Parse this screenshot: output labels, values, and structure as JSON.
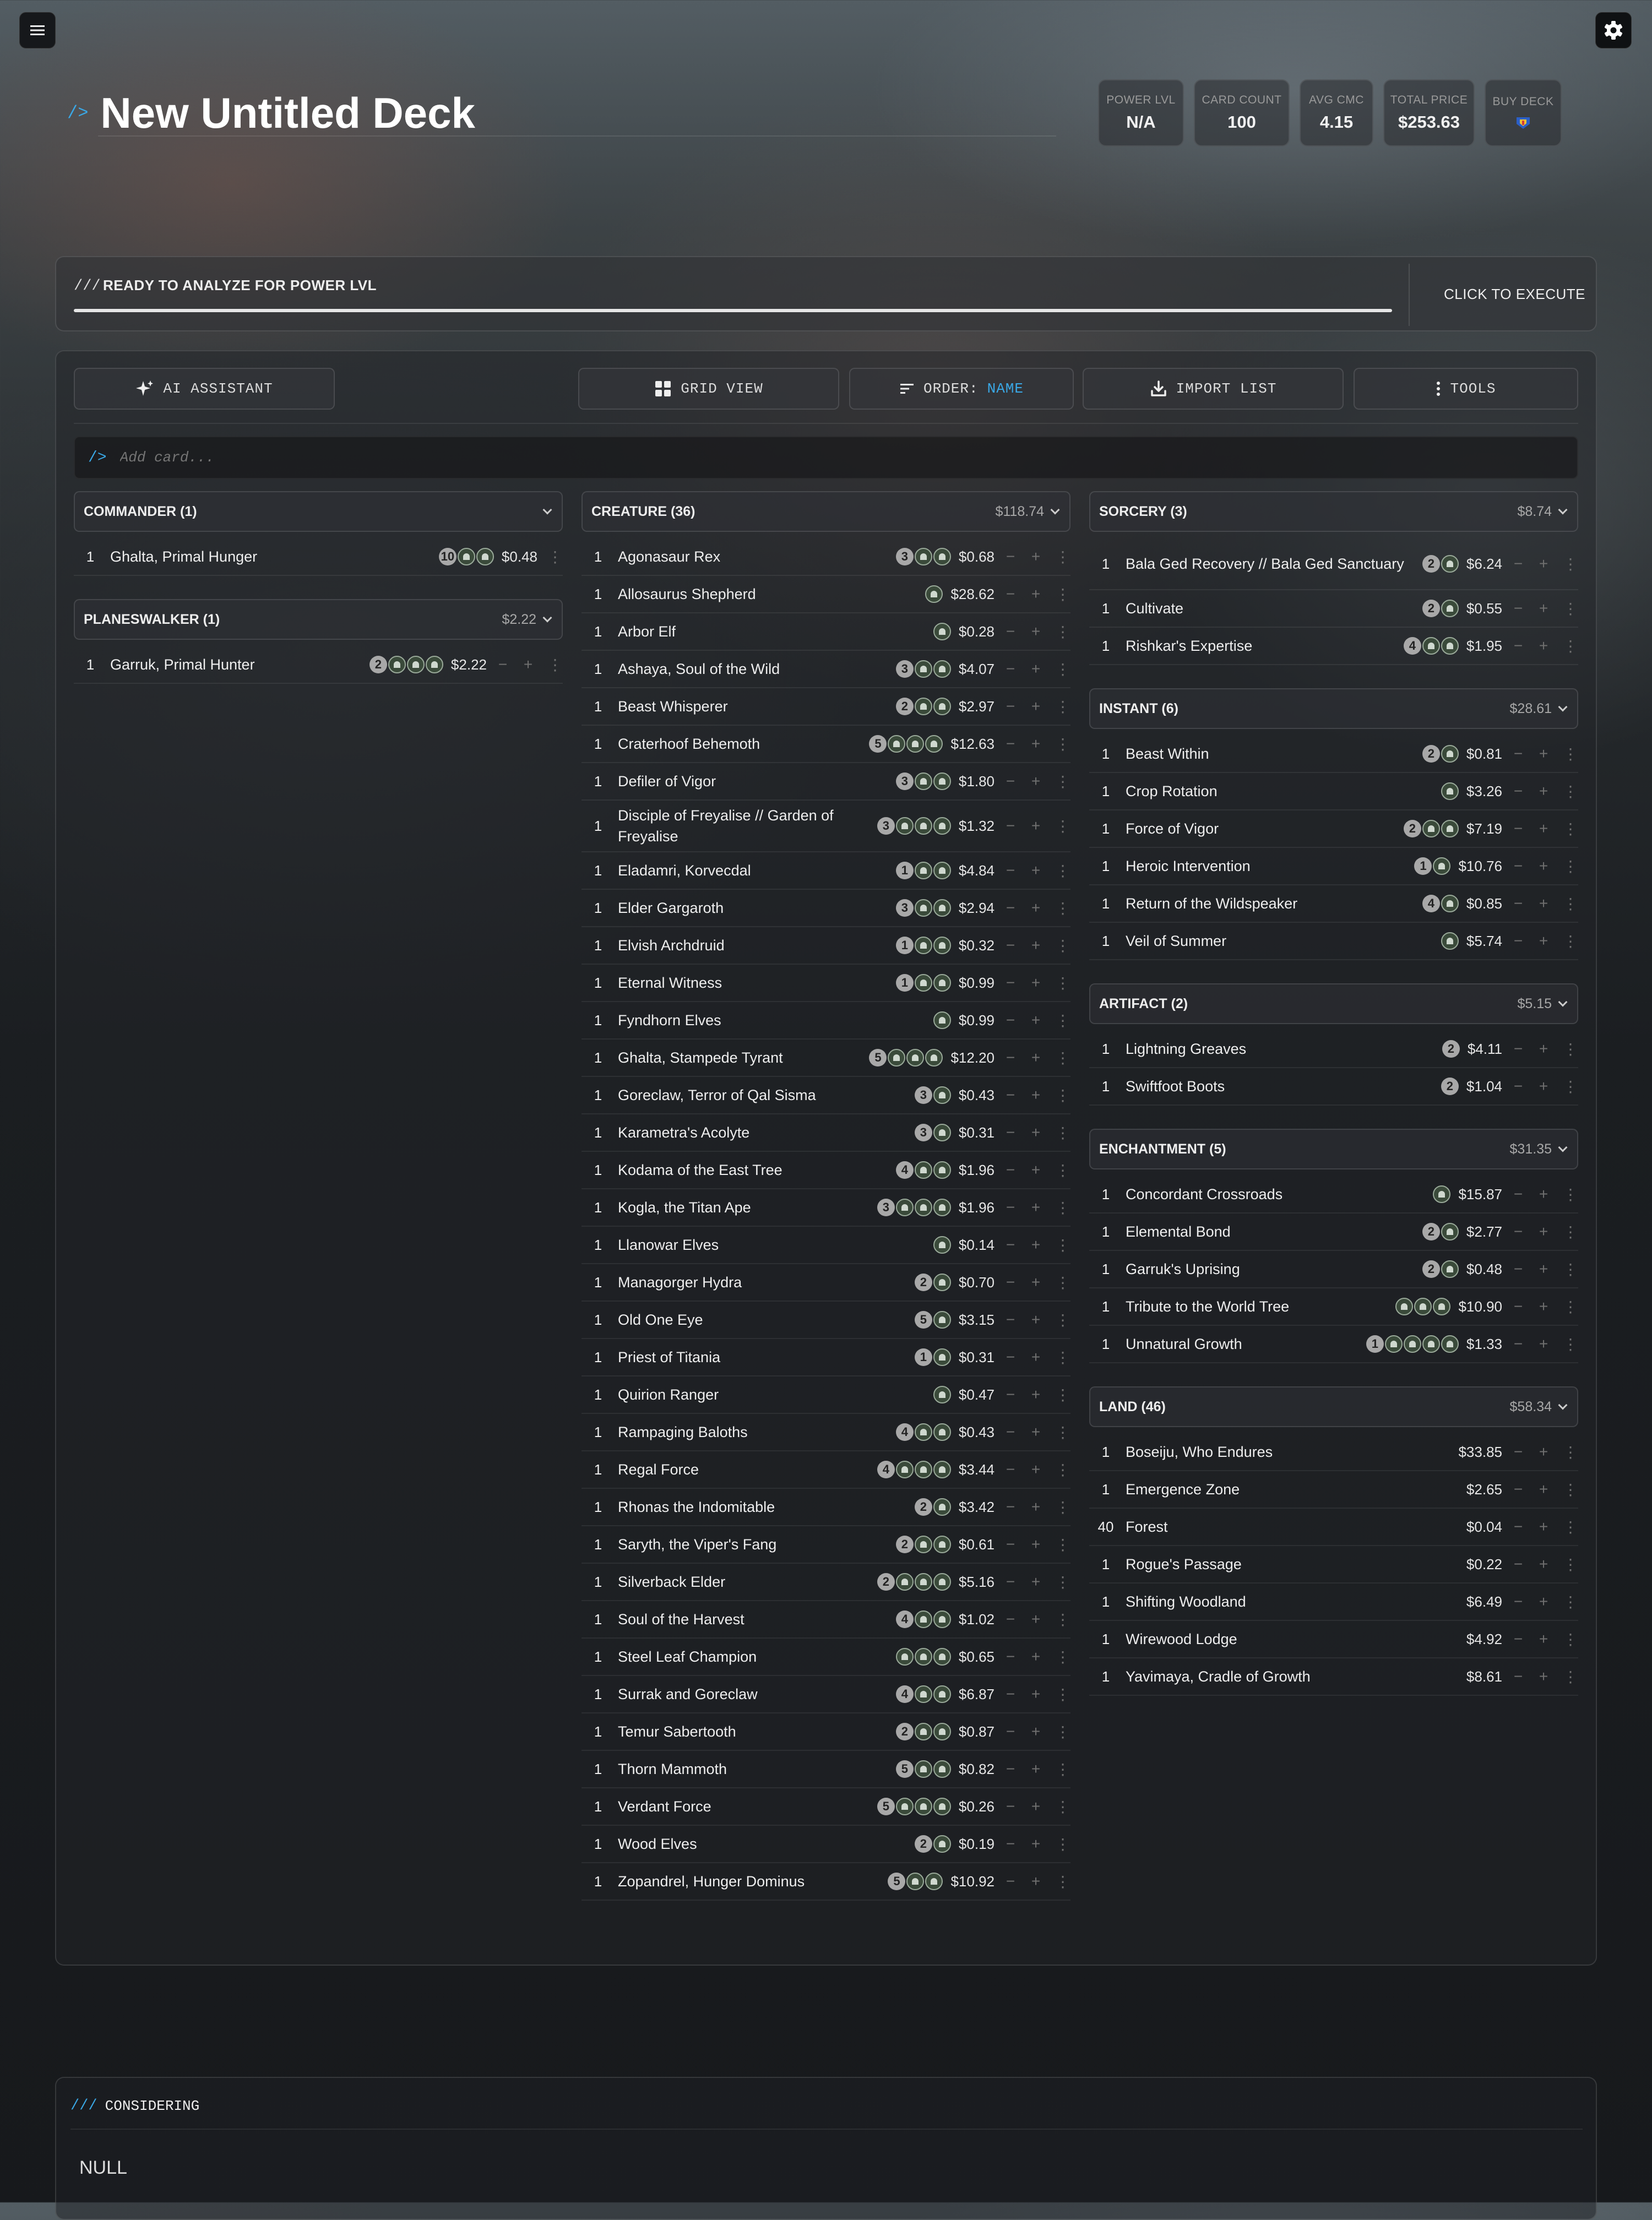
{
  "header": {
    "title_prefix": "/>",
    "title": "New Untitled Deck",
    "stats": [
      {
        "label": "POWER LVL",
        "value": "N/A"
      },
      {
        "label": "CARD COUNT",
        "value": "100"
      },
      {
        "label": "AVG CMC",
        "value": "4.15"
      },
      {
        "label": "TOTAL PRICE",
        "value": "$253.63"
      },
      {
        "label": "BUY DECK",
        "value": ""
      }
    ]
  },
  "analyze": {
    "prefix": "///",
    "label": "READY TO ANALYZE FOR POWER LVL",
    "execute": "CLICK TO EXECUTE"
  },
  "toolbar": {
    "ai": "AI ASSISTANT",
    "grid": "GRID VIEW",
    "order_label": "ORDER:",
    "order_value": "NAME",
    "import": "IMPORT LIST",
    "tools": "TOOLS"
  },
  "add_card": {
    "prefix": "/>",
    "placeholder": "Add card..."
  },
  "colors": {
    "accent": "#3aa8e6",
    "mana_green": "#9aaa9a",
    "mana_generic": "#a8a8a8"
  },
  "columns": [
    {
      "sections": [
        {
          "name": "COMMANDER (1)",
          "price": "",
          "cards": [
            {
              "qty": "1",
              "name": "Ghalta, Primal Hunger",
              "cost": [
                "10",
                "G",
                "G"
              ],
              "price": "$0.48",
              "controls": false
            }
          ]
        },
        {
          "name": "PLANESWALKER (1)",
          "price": "$2.22",
          "cards": [
            {
              "qty": "1",
              "name": "Garruk, Primal Hunter",
              "cost": [
                "2",
                "G",
                "G",
                "G"
              ],
              "price": "$2.22"
            }
          ]
        }
      ]
    },
    {
      "sections": [
        {
          "name": "CREATURE (36)",
          "price": "$118.74",
          "cards": [
            {
              "qty": "1",
              "name": "Agonasaur Rex",
              "cost": [
                "3",
                "G",
                "G"
              ],
              "price": "$0.68"
            },
            {
              "qty": "1",
              "name": "Allosaurus Shepherd",
              "cost": [
                "G"
              ],
              "price": "$28.62"
            },
            {
              "qty": "1",
              "name": "Arbor Elf",
              "cost": [
                "G"
              ],
              "price": "$0.28"
            },
            {
              "qty": "1",
              "name": "Ashaya, Soul of the Wild",
              "cost": [
                "3",
                "G",
                "G"
              ],
              "price": "$4.07"
            },
            {
              "qty": "1",
              "name": "Beast Whisperer",
              "cost": [
                "2",
                "G",
                "G"
              ],
              "price": "$2.97"
            },
            {
              "qty": "1",
              "name": "Craterhoof Behemoth",
              "cost": [
                "5",
                "G",
                "G",
                "G"
              ],
              "price": "$12.63"
            },
            {
              "qty": "1",
              "name": "Defiler of Vigor",
              "cost": [
                "3",
                "G",
                "G"
              ],
              "price": "$1.80"
            },
            {
              "qty": "1",
              "name": "Disciple of Freyalise // Garden of Freyalise",
              "cost": [
                "3",
                "G",
                "G",
                "G"
              ],
              "price": "$1.32",
              "tall": true
            },
            {
              "qty": "1",
              "name": "Eladamri, Korvecdal",
              "cost": [
                "1",
                "G",
                "G"
              ],
              "price": "$4.84"
            },
            {
              "qty": "1",
              "name": "Elder Gargaroth",
              "cost": [
                "3",
                "G",
                "G"
              ],
              "price": "$2.94"
            },
            {
              "qty": "1",
              "name": "Elvish Archdruid",
              "cost": [
                "1",
                "G",
                "G"
              ],
              "price": "$0.32"
            },
            {
              "qty": "1",
              "name": "Eternal Witness",
              "cost": [
                "1",
                "G",
                "G"
              ],
              "price": "$0.99"
            },
            {
              "qty": "1",
              "name": "Fyndhorn Elves",
              "cost": [
                "G"
              ],
              "price": "$0.99"
            },
            {
              "qty": "1",
              "name": "Ghalta, Stampede Tyrant",
              "cost": [
                "5",
                "G",
                "G",
                "G"
              ],
              "price": "$12.20"
            },
            {
              "qty": "1",
              "name": "Goreclaw, Terror of Qal Sisma",
              "cost": [
                "3",
                "G"
              ],
              "price": "$0.43"
            },
            {
              "qty": "1",
              "name": "Karametra's Acolyte",
              "cost": [
                "3",
                "G"
              ],
              "price": "$0.31"
            },
            {
              "qty": "1",
              "name": "Kodama of the East Tree",
              "cost": [
                "4",
                "G",
                "G"
              ],
              "price": "$1.96"
            },
            {
              "qty": "1",
              "name": "Kogla, the Titan Ape",
              "cost": [
                "3",
                "G",
                "G",
                "G"
              ],
              "price": "$1.96"
            },
            {
              "qty": "1",
              "name": "Llanowar Elves",
              "cost": [
                "G"
              ],
              "price": "$0.14"
            },
            {
              "qty": "1",
              "name": "Managorger Hydra",
              "cost": [
                "2",
                "G"
              ],
              "price": "$0.70"
            },
            {
              "qty": "1",
              "name": "Old One Eye",
              "cost": [
                "5",
                "G"
              ],
              "price": "$3.15"
            },
            {
              "qty": "1",
              "name": "Priest of Titania",
              "cost": [
                "1",
                "G"
              ],
              "price": "$0.31"
            },
            {
              "qty": "1",
              "name": "Quirion Ranger",
              "cost": [
                "G"
              ],
              "price": "$0.47"
            },
            {
              "qty": "1",
              "name": "Rampaging Baloths",
              "cost": [
                "4",
                "G",
                "G"
              ],
              "price": "$0.43"
            },
            {
              "qty": "1",
              "name": "Regal Force",
              "cost": [
                "4",
                "G",
                "G",
                "G"
              ],
              "price": "$3.44"
            },
            {
              "qty": "1",
              "name": "Rhonas the Indomitable",
              "cost": [
                "2",
                "G"
              ],
              "price": "$3.42"
            },
            {
              "qty": "1",
              "name": "Saryth, the Viper's Fang",
              "cost": [
                "2",
                "G",
                "G"
              ],
              "price": "$0.61"
            },
            {
              "qty": "1",
              "name": "Silverback Elder",
              "cost": [
                "2",
                "G",
                "G",
                "G"
              ],
              "price": "$5.16"
            },
            {
              "qty": "1",
              "name": "Soul of the Harvest",
              "cost": [
                "4",
                "G",
                "G"
              ],
              "price": "$1.02"
            },
            {
              "qty": "1",
              "name": "Steel Leaf Champion",
              "cost": [
                "G",
                "G",
                "G"
              ],
              "price": "$0.65"
            },
            {
              "qty": "1",
              "name": "Surrak and Goreclaw",
              "cost": [
                "4",
                "G",
                "G"
              ],
              "price": "$6.87"
            },
            {
              "qty": "1",
              "name": "Temur Sabertooth",
              "cost": [
                "2",
                "G",
                "G"
              ],
              "price": "$0.87"
            },
            {
              "qty": "1",
              "name": "Thorn Mammoth",
              "cost": [
                "5",
                "G",
                "G"
              ],
              "price": "$0.82"
            },
            {
              "qty": "1",
              "name": "Verdant Force",
              "cost": [
                "5",
                "G",
                "G",
                "G"
              ],
              "price": "$0.26"
            },
            {
              "qty": "1",
              "name": "Wood Elves",
              "cost": [
                "2",
                "G"
              ],
              "price": "$0.19"
            },
            {
              "qty": "1",
              "name": "Zopandrel, Hunger Dominus",
              "cost": [
                "5",
                "G",
                "G"
              ],
              "price": "$10.92"
            }
          ]
        }
      ]
    },
    {
      "sections": [
        {
          "name": "SORCERY (3)",
          "price": "$8.74",
          "cards": [
            {
              "qty": "1",
              "name": "Bala Ged Recovery // Bala Ged Sanctuary",
              "cost": [
                "2",
                "G"
              ],
              "price": "$6.24",
              "tall": true
            },
            {
              "qty": "1",
              "name": "Cultivate",
              "cost": [
                "2",
                "G"
              ],
              "price": "$0.55"
            },
            {
              "qty": "1",
              "name": "Rishkar's Expertise",
              "cost": [
                "4",
                "G",
                "G"
              ],
              "price": "$1.95"
            }
          ]
        },
        {
          "name": "INSTANT (6)",
          "price": "$28.61",
          "cards": [
            {
              "qty": "1",
              "name": "Beast Within",
              "cost": [
                "2",
                "G"
              ],
              "price": "$0.81"
            },
            {
              "qty": "1",
              "name": "Crop Rotation",
              "cost": [
                "G"
              ],
              "price": "$3.26"
            },
            {
              "qty": "1",
              "name": "Force of Vigor",
              "cost": [
                "2",
                "G",
                "G"
              ],
              "price": "$7.19"
            },
            {
              "qty": "1",
              "name": "Heroic Intervention",
              "cost": [
                "1",
                "G"
              ],
              "price": "$10.76"
            },
            {
              "qty": "1",
              "name": "Return of the Wildspeaker",
              "cost": [
                "4",
                "G"
              ],
              "price": "$0.85"
            },
            {
              "qty": "1",
              "name": "Veil of Summer",
              "cost": [
                "G"
              ],
              "price": "$5.74"
            }
          ]
        },
        {
          "name": "ARTIFACT (2)",
          "price": "$5.15",
          "cards": [
            {
              "qty": "1",
              "name": "Lightning Greaves",
              "cost": [
                "2"
              ],
              "price": "$4.11"
            },
            {
              "qty": "1",
              "name": "Swiftfoot Boots",
              "cost": [
                "2"
              ],
              "price": "$1.04"
            }
          ]
        },
        {
          "name": "ENCHANTMENT (5)",
          "price": "$31.35",
          "cards": [
            {
              "qty": "1",
              "name": "Concordant Crossroads",
              "cost": [
                "G"
              ],
              "price": "$15.87"
            },
            {
              "qty": "1",
              "name": "Elemental Bond",
              "cost": [
                "2",
                "G"
              ],
              "price": "$2.77"
            },
            {
              "qty": "1",
              "name": "Garruk's Uprising",
              "cost": [
                "2",
                "G"
              ],
              "price": "$0.48"
            },
            {
              "qty": "1",
              "name": "Tribute to the World Tree",
              "cost": [
                "G",
                "G",
                "G"
              ],
              "price": "$10.90"
            },
            {
              "qty": "1",
              "name": "Unnatural Growth",
              "cost": [
                "1",
                "G",
                "G",
                "G",
                "G"
              ],
              "price": "$1.33"
            }
          ]
        },
        {
          "name": "LAND (46)",
          "price": "$58.34",
          "cards": [
            {
              "qty": "1",
              "name": "Boseiju, Who Endures",
              "cost": [],
              "price": "$33.85"
            },
            {
              "qty": "1",
              "name": "Emergence Zone",
              "cost": [],
              "price": "$2.65"
            },
            {
              "qty": "40",
              "name": "Forest",
              "cost": [],
              "price": "$0.04"
            },
            {
              "qty": "1",
              "name": "Rogue's Passage",
              "cost": [],
              "price": "$0.22"
            },
            {
              "qty": "1",
              "name": "Shifting Woodland",
              "cost": [],
              "price": "$6.49"
            },
            {
              "qty": "1",
              "name": "Wirewood Lodge",
              "cost": [],
              "price": "$4.92"
            },
            {
              "qty": "1",
              "name": "Yavimaya, Cradle of Growth",
              "cost": [],
              "price": "$8.61"
            }
          ]
        }
      ]
    }
  ],
  "considering": {
    "prefix": "///",
    "title": "CONSIDERING",
    "value": "NULL"
  }
}
